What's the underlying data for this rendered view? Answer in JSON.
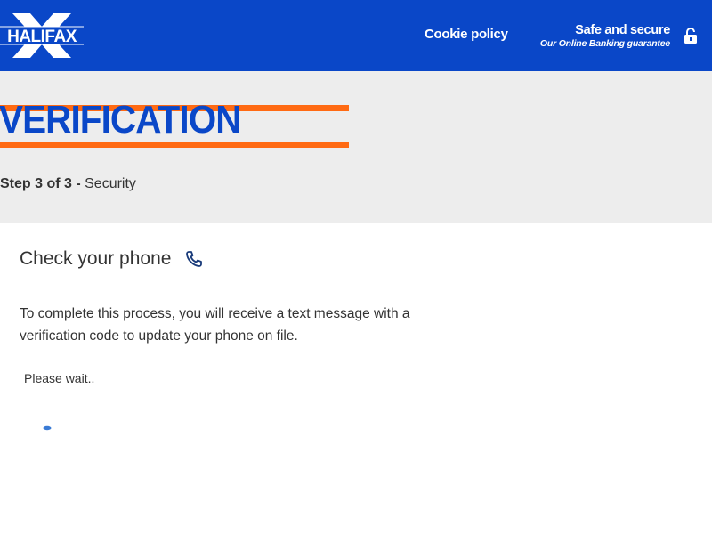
{
  "header": {
    "logo_text": "HALIFAX",
    "cookie_label": "Cookie policy",
    "secure_title": "Safe and secure",
    "secure_subtitle": "Our Online Banking guarantee",
    "lock_icon": "lock-icon"
  },
  "banner": {
    "title": "VERIFICATION",
    "step_prefix": "Step 3 of 3 - ",
    "step_name": "Security"
  },
  "main": {
    "heading": "Check your phone",
    "phone_icon": "phone-icon",
    "description": "To complete this process, you will receive a text message with a verification code to update your phone on file.",
    "wait_text": "Please wait.."
  },
  "colors": {
    "brand_blue": "#0a47c8",
    "accent_orange": "#ff6a13",
    "banner_gray": "#ededed",
    "text_dark": "#333333"
  }
}
